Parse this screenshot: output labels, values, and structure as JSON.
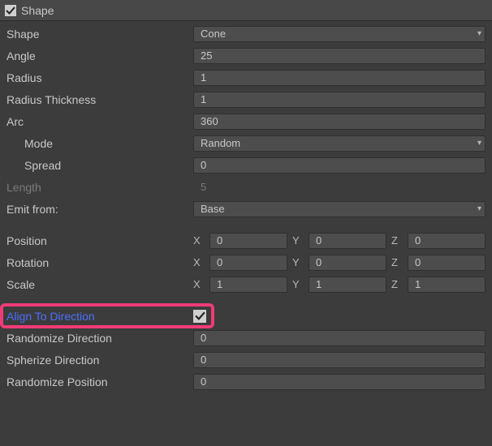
{
  "header": {
    "title": "Shape",
    "checked": true
  },
  "fields": {
    "shape": {
      "label": "Shape",
      "value": "Cone"
    },
    "angle": {
      "label": "Angle",
      "value": "25"
    },
    "radius": {
      "label": "Radius",
      "value": "1"
    },
    "radiusThickness": {
      "label": "Radius Thickness",
      "value": "1"
    },
    "arc": {
      "label": "Arc",
      "value": "360"
    },
    "mode": {
      "label": "Mode",
      "value": "Random"
    },
    "spread": {
      "label": "Spread",
      "value": "0"
    },
    "length": {
      "label": "Length",
      "value": "5"
    },
    "emitFrom": {
      "label": "Emit from:",
      "value": "Base"
    },
    "position": {
      "label": "Position",
      "x": "0",
      "y": "0",
      "z": "0"
    },
    "rotation": {
      "label": "Rotation",
      "x": "0",
      "y": "0",
      "z": "0"
    },
    "scale": {
      "label": "Scale",
      "x": "1",
      "y": "1",
      "z": "1"
    },
    "alignToDirection": {
      "label": "Align To Direction",
      "checked": true
    },
    "randomizeDirection": {
      "label": "Randomize Direction",
      "value": "0"
    },
    "spherizeDirection": {
      "label": "Spherize Direction",
      "value": "0"
    },
    "randomizePosition": {
      "label": "Randomize Position",
      "value": "0"
    }
  },
  "axisLabels": {
    "x": "X",
    "y": "Y",
    "z": "Z"
  }
}
